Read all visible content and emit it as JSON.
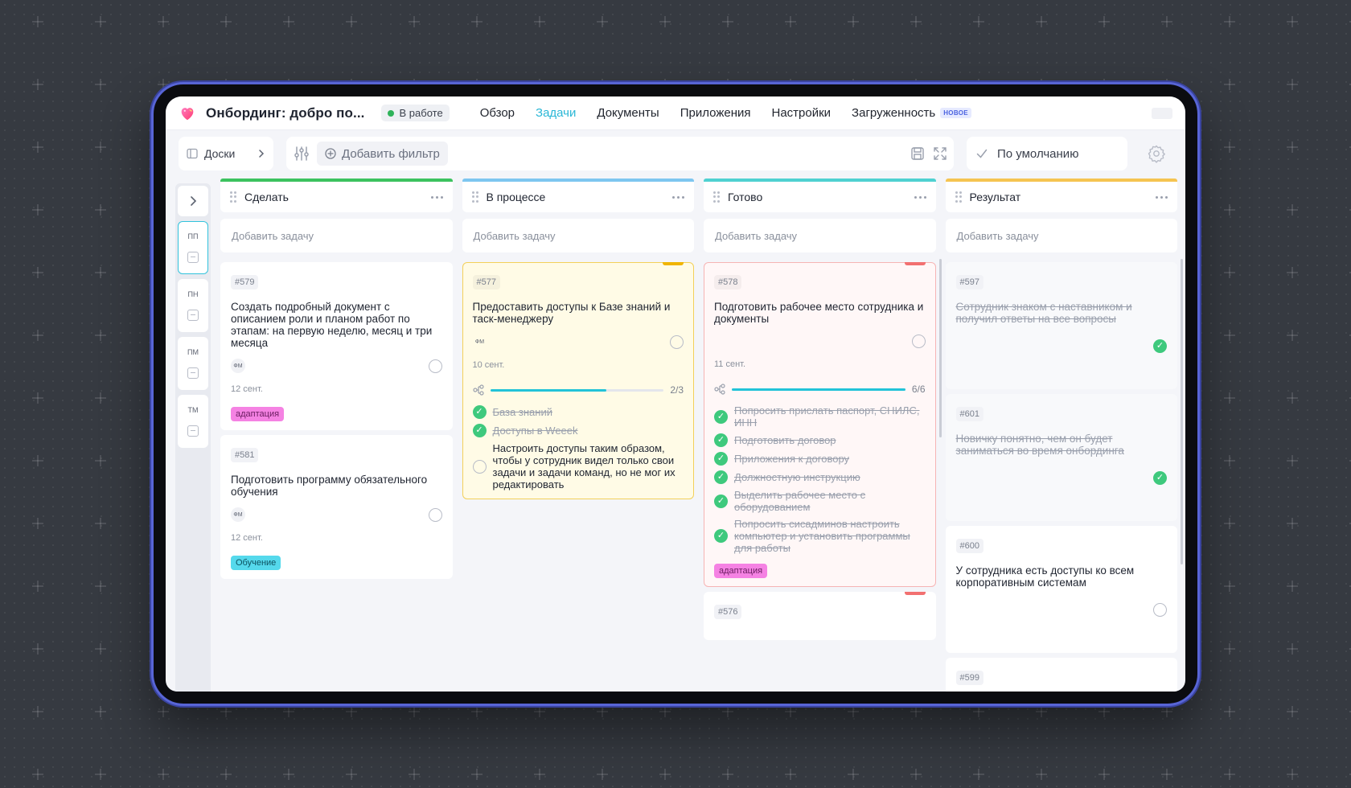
{
  "header": {
    "project_title": "Онбординг: добро по...",
    "status": "В работе",
    "nav": [
      {
        "label": "Обзор",
        "active": false
      },
      {
        "label": "Задачи",
        "active": true
      },
      {
        "label": "Документы",
        "active": false
      },
      {
        "label": "Приложения",
        "active": false
      },
      {
        "label": "Настройки",
        "active": false
      },
      {
        "label": "Загруженность",
        "active": false,
        "badge": "НОВОЕ"
      }
    ]
  },
  "toolbar": {
    "boards_label": "Доски",
    "add_filter_label": "Добавить фильтр",
    "default_view_label": "По умолчанию"
  },
  "rail": {
    "groups": [
      "ПП",
      "ПН",
      "ПМ",
      "ТМ"
    ]
  },
  "add_task_label": "Добавить задачу",
  "colors": {
    "accent": "#2ab7d6",
    "col_todo": "#3cc25f",
    "col_progress": "#7ec6f0",
    "col_done": "#4fd1d1",
    "col_result": "#f5c451"
  },
  "columns": [
    {
      "title": "Сделать",
      "cards": [
        {
          "id": "#579",
          "title": "Создать подробный документ с описанием роли и планом работ по этапам: на первую неделю, месяц и три месяца",
          "assignee": "ФМ",
          "date": "12 сент.",
          "tag": "адаптация"
        },
        {
          "id": "#581",
          "title": "Подготовить программу обязательного обучения",
          "assignee": "ФМ",
          "date": "12 сент.",
          "tag": "Обучение"
        }
      ]
    },
    {
      "title": "В процессе",
      "cards": [
        {
          "id": "#577",
          "title": "Предоставить доступы к Базе знаний и таск-менеджеру",
          "assignee": "ФМ",
          "date": "10 сент.",
          "progress": "2/3",
          "progress_fraction": 0.67,
          "subtasks": [
            {
              "text": "База знаний",
              "done": true
            },
            {
              "text": "Доступы в Weeek",
              "done": true
            },
            {
              "text": "Настроить доступы таким образом, чтобы у сотрудник видел только свои задачи и задачи команд, но не мог их редактировать",
              "done": false
            }
          ]
        }
      ]
    },
    {
      "title": "Готово",
      "cards": [
        {
          "id": "#578",
          "title": "Подготовить рабочее место сотрудника и документы",
          "date": "11 сент.",
          "progress": "6/6",
          "progress_fraction": 1.0,
          "tag": "адаптация",
          "subtasks": [
            {
              "text": "Попросить прислать паспорт, СНИЛС, ИНН",
              "done": true
            },
            {
              "text": "Подготовить договор",
              "done": true
            },
            {
              "text": "Приложения к договору",
              "done": true
            },
            {
              "text": "Должностную инструкцию",
              "done": true
            },
            {
              "text": "Выделить рабочее место с оборудованием",
              "done": true
            },
            {
              "text": "Попросить сисадминов настроить компьютер и установить программы для работы",
              "done": true
            }
          ]
        },
        {
          "id": "#576"
        }
      ]
    },
    {
      "title": "Результат",
      "cards": [
        {
          "id": "#597",
          "title": "Сотрудник знаком с наставником и получил ответы на все вопросы",
          "done": true
        },
        {
          "id": "#601",
          "title": "Новичку понятно, чем он будет заниматься во время онбординга",
          "done": true
        },
        {
          "id": "#600",
          "title": "У сотрудника есть доступы ко всем корпоративным системам",
          "done": false
        },
        {
          "id": "#599"
        }
      ]
    }
  ]
}
